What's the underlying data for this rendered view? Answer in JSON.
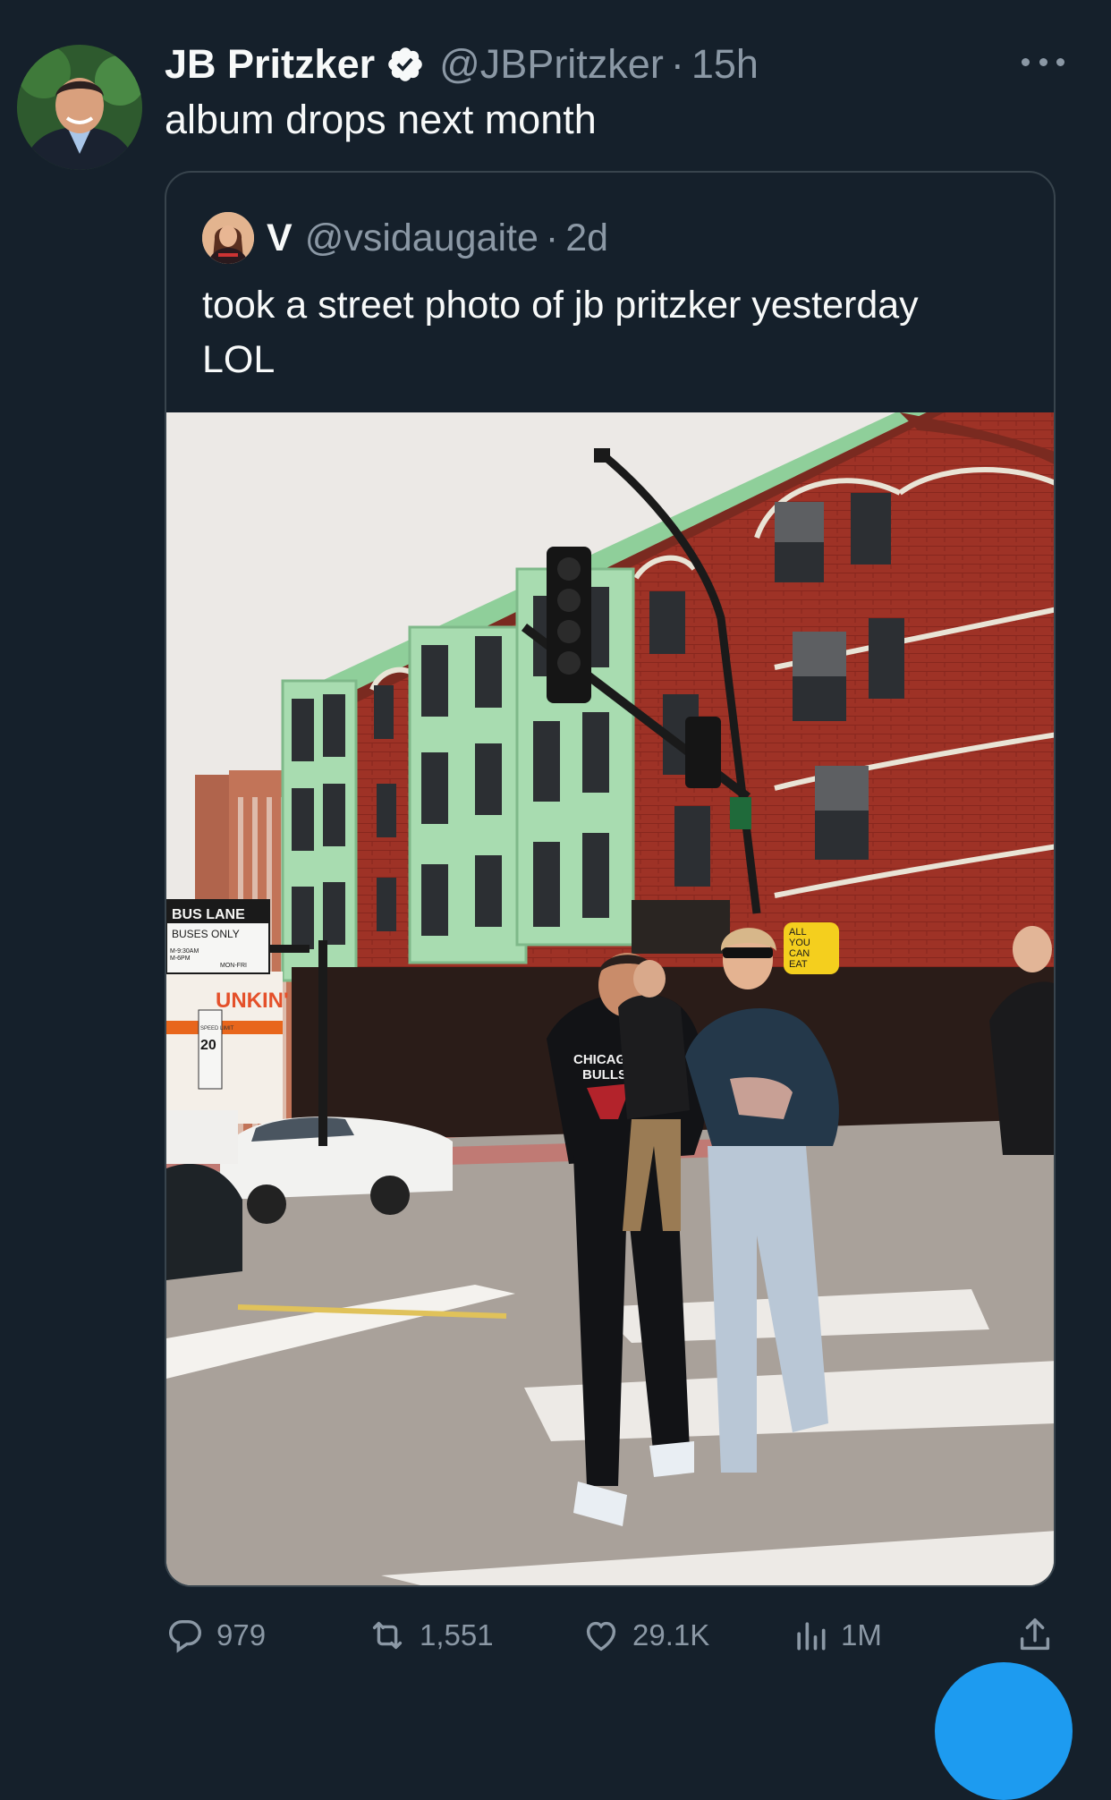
{
  "tweet": {
    "author_name": "JB Pritzker",
    "handle": "@JBPritzker",
    "separator": "·",
    "time": "15h",
    "text": "album drops next month"
  },
  "quote": {
    "author_name": "V",
    "handle": "@vsidaugaite",
    "separator": "·",
    "time": "2d",
    "text_line1": "took a street photo of jb pritzker yesterday",
    "text_line2": "LOL",
    "photo_signs": {
      "bus_lane": "BUS LANE",
      "buses_only": "BUSES ONLY",
      "hours": "M-9:30AM",
      "hours2": "M-6PM",
      "days": "MON-FRI",
      "speed_limit": "20",
      "speed_label": "SPEED LIMIT",
      "store": "UNKIN'",
      "shop_sign_1": "ALL",
      "shop_sign_2": "YOU",
      "shop_sign_3": "CAN",
      "shop_sign_4": "EAT",
      "hoodie_1": "CHICAGO",
      "hoodie_2": "BULLS"
    }
  },
  "actions": {
    "replies": "979",
    "reposts": "1,551",
    "likes": "29.1K",
    "views": "1M"
  },
  "colors": {
    "background": "#15202b",
    "text": "#f7f9f9",
    "muted": "#8b98a5",
    "border": "#38444d",
    "accent": "#1d9bf0"
  }
}
